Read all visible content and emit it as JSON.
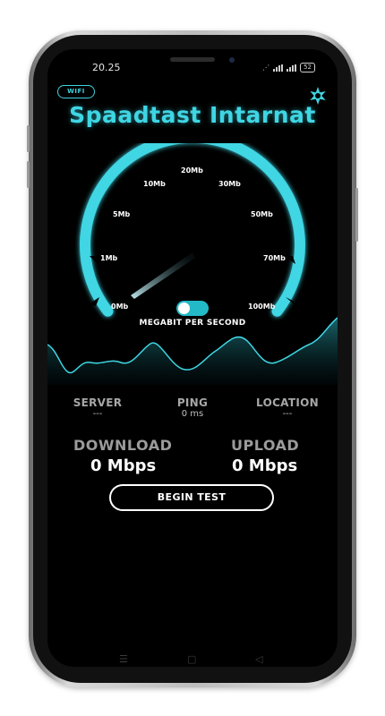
{
  "status_bar": {
    "time": "20.25",
    "battery": "52"
  },
  "header": {
    "network_badge": "WIFI",
    "title": "Spaadtast Intarnat",
    "settings_icon": "star-gear-icon"
  },
  "gauge": {
    "ticks": [
      "0Mb",
      "1Mb",
      "5Mb",
      "10Mb",
      "20Mb",
      "30Mb",
      "50Mb",
      "70Mb",
      "100Mb"
    ],
    "needle_value": "0Mb",
    "unit_toggle_on": true,
    "unit_label": "MEGABIT PER SECOND"
  },
  "stats": {
    "server_label": "SERVER",
    "server_value": "---",
    "ping_label": "PING",
    "ping_value": "0 ms",
    "location_label": "LOCATION",
    "location_value": "---"
  },
  "results": {
    "download_label": "DOWNLOAD",
    "download_value": "0 Mbps",
    "upload_label": "UPLOAD",
    "upload_value": "0 Mbps"
  },
  "actions": {
    "begin_label": "BEGIN TEST"
  },
  "colors": {
    "accent": "#40d3e0",
    "background": "#000000",
    "text": "#ffffff"
  },
  "nav_icons": [
    "menu-icon",
    "home-icon",
    "back-icon"
  ]
}
